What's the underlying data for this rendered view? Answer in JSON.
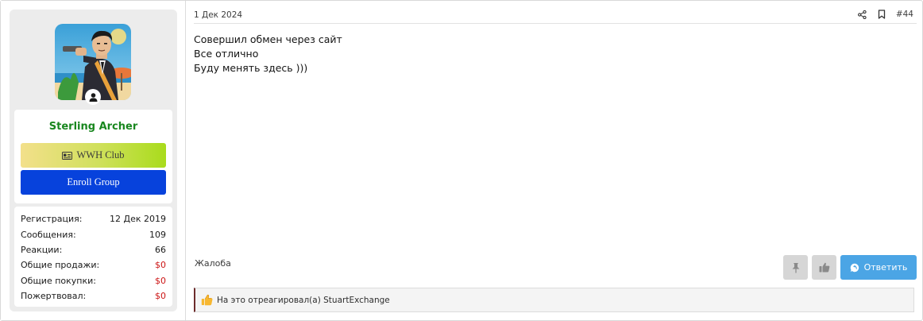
{
  "user": {
    "name": "Sterling Archer",
    "banners": {
      "wwh": "WWH Club",
      "enroll": "Enroll Group"
    },
    "stats": [
      {
        "label": "Регистрация:",
        "value": "12 Дек 2019",
        "highlight": false
      },
      {
        "label": "Сообщения:",
        "value": "109",
        "highlight": false
      },
      {
        "label": "Реакции:",
        "value": "66",
        "highlight": false
      },
      {
        "label": "Общие продажи:",
        "value": "$0",
        "highlight": true
      },
      {
        "label": "Общие покупки:",
        "value": "$0",
        "highlight": true
      },
      {
        "label": "Пожертвовал:",
        "value": "$0",
        "highlight": true
      }
    ]
  },
  "post": {
    "date": "1 Дек 2024",
    "number": "#44",
    "lines": [
      "Совершил обмен через сайт",
      "Все отлично",
      "Буду менять здесь )))"
    ],
    "report": "Жалоба",
    "reply": "Ответить",
    "reactions": "На это отреагировал(а) StuartExchange"
  },
  "icons": {
    "share": "share-icon",
    "bookmark": "bookmark-icon",
    "pin": "pin-icon",
    "like": "thumbs-up-icon",
    "reply": "reply-bubble-icon",
    "reaction": "thumbs-up-reaction-icon",
    "online": "user-online-icon",
    "banner": "id-card-icon"
  },
  "colors": {
    "username": "#19871f",
    "enroll_bg": "#0742dc",
    "reply_bg": "#4ba5e5",
    "money": "#cc1414"
  }
}
